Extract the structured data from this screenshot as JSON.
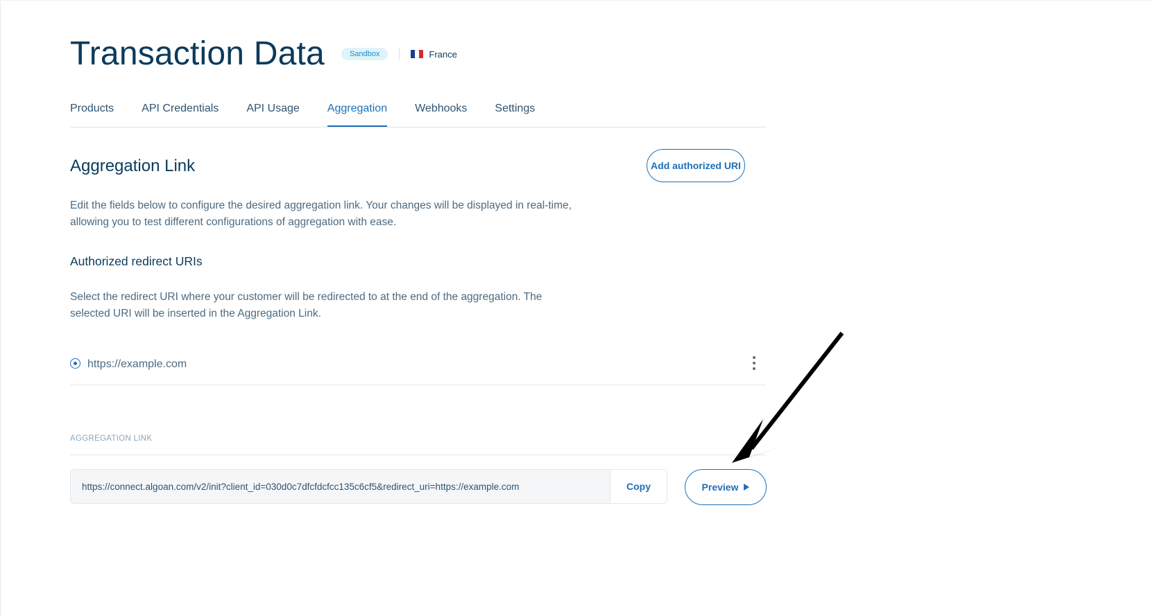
{
  "header": {
    "title": "Transaction Data",
    "environment_badge": "Sandbox",
    "country": "France"
  },
  "tabs": [
    {
      "label": "Products",
      "active": false
    },
    {
      "label": "API Credentials",
      "active": false
    },
    {
      "label": "API Usage",
      "active": false
    },
    {
      "label": "Aggregation",
      "active": true
    },
    {
      "label": "Webhooks",
      "active": false
    },
    {
      "label": "Settings",
      "active": false
    }
  ],
  "aggregation": {
    "title": "Aggregation Link",
    "add_uri_label": "Add authorized URI",
    "description": "Edit the fields below to configure the desired aggregation link. Your changes will be displayed in real-time, allowing you to test different configurations of aggregation with ease.",
    "redirect_title": "Authorized redirect URIs",
    "redirect_description": "Select the redirect URI where your customer will be redirected to at the end of the aggregation. The selected URI will be inserted in the Aggregation Link.",
    "selected_uri": "https://example.com",
    "link_label": "AGGREGATION LINK",
    "link_value": "https://connect.algoan.com/v2/init?client_id=030d0c7dfcfdcfcc135c6cf5&redirect_uri=https://example.com",
    "copy_label": "Copy",
    "preview_label": "Preview"
  },
  "colors": {
    "accent": "#1d6fb8",
    "title": "#0b3a5b",
    "muted_text": "#4d6a80",
    "badge_bg": "#dff3fb"
  },
  "icons": [
    "france-flag-icon",
    "radio-selected-icon",
    "more-vertical-icon",
    "play-icon",
    "annotation-arrow"
  ]
}
